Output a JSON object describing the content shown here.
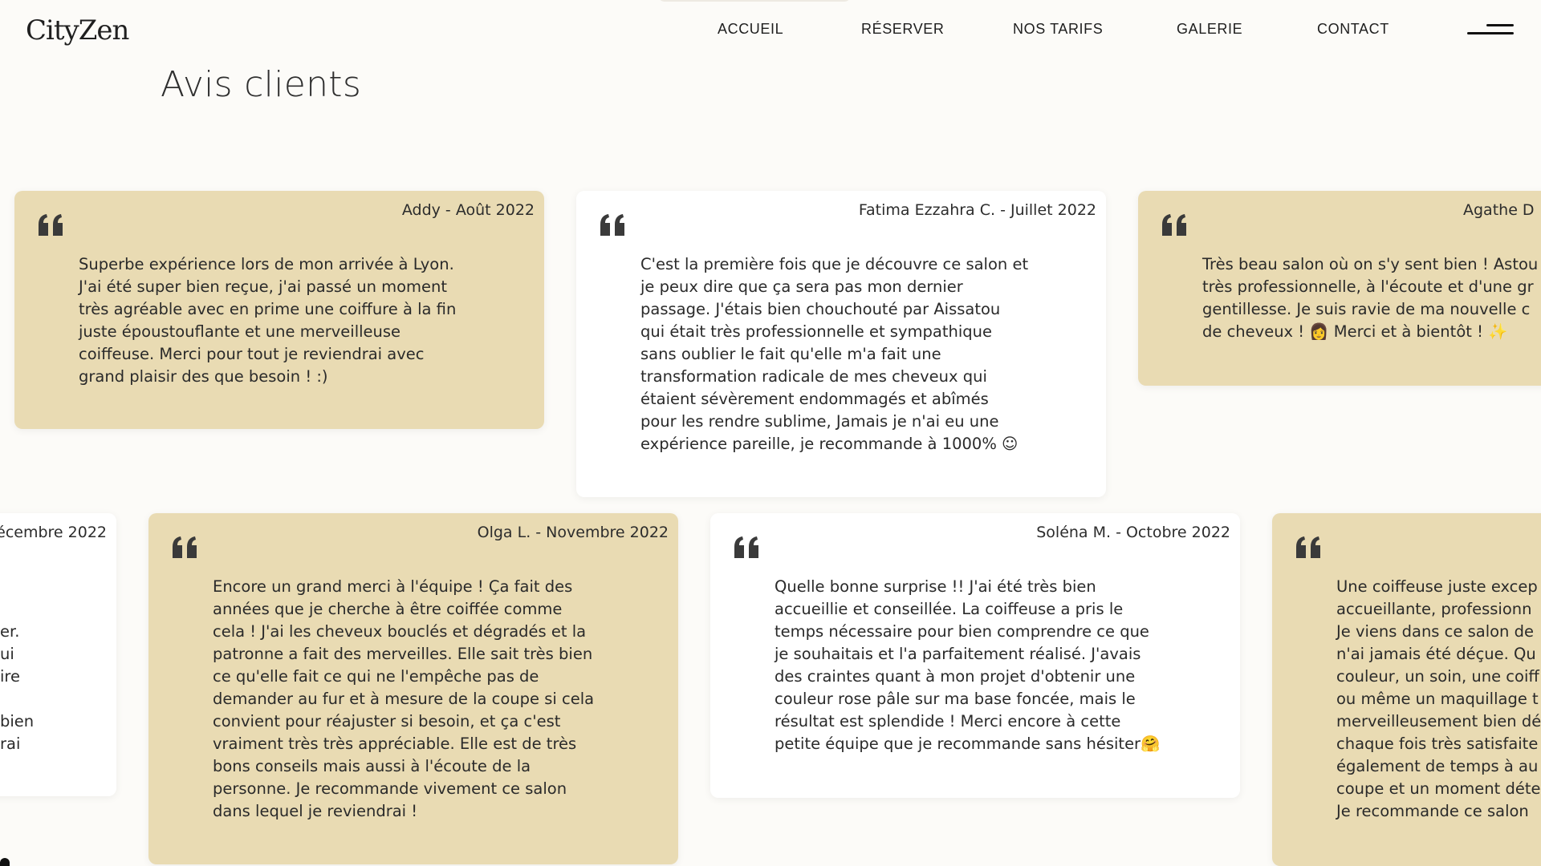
{
  "brand": {
    "logo": "CityZen"
  },
  "nav": {
    "items": [
      "ACCUEIL",
      "RÉSERVER",
      "NOS TARIFS",
      "GALERIE",
      "CONTACT"
    ]
  },
  "page": {
    "title": "Avis clients"
  },
  "reviews": [
    {
      "author": "Addy - Août 2022",
      "lines": [
        "Superbe expérience lors de mon arrivée à Lyon.",
        "J'ai été super bien reçue, j'ai passé un moment",
        "très agréable avec en prime une coiffure à la fin",
        "juste époustouflante et une merveilleuse",
        "coiffeuse. Merci pour tout je reviendrai avec",
        "grand plaisir des que besoin ! :)"
      ]
    },
    {
      "author": "Fatima Ezzahra C. - Juillet 2022",
      "lines": [
        "C'est la première fois que je découvre ce salon et",
        "je peux dire que ça sera pas mon dernier",
        "passage. J'étais bien chouchouté par Aissatou",
        "qui était très professionnelle et sympathique",
        "sans oublier le fait qu'elle m'a fait une",
        "transformation radicale de mes cheveux qui",
        "étaient sévèrement endommagés et abîmés",
        "pour les rendre sublime, Jamais je n'ai eu une",
        "expérience pareille, je recommande à 1000% ☺"
      ]
    },
    {
      "author": "Agathe D",
      "lines": [
        "Très beau salon où on s'y sent bien ! Astou",
        "très professionnelle, à l'écoute et d'une gr",
        "gentillesse. Je suis ravie de ma nouvelle c",
        "de cheveux ! 👩 Merci et à bientôt ! ✨"
      ]
    },
    {
      "author": "écembre 2022",
      "lines": [
        "",
        "",
        "er.",
        "ui",
        "ire",
        "",
        "bien",
        "rai"
      ]
    },
    {
      "author": "Olga L. - Novembre 2022",
      "lines": [
        "Encore un grand merci à l'équipe ! Ça fait des",
        "années que je cherche à être coiffée comme",
        "cela ! J'ai les cheveux bouclés et dégradés et la",
        "patronne a fait des merveilles. Elle sait très bien",
        "ce qu'elle fait ce qui ne l'empêche pas de",
        "demander au fur et à mesure de la coupe si cela",
        "convient pour réajuster si besoin, et ça c'est",
        "vraiment très très appréciable. Elle est de très",
        "bons conseils mais aussi à l'écoute de la",
        "personne. Je recommande vivement ce salon",
        "dans lequel je reviendrai !"
      ]
    },
    {
      "author": "Soléna M. - Octobre 2022",
      "lines": [
        "Quelle bonne surprise !! J'ai été très bien",
        "accueillie et conseillée. La coiffeuse a pris le",
        "temps nécessaire pour bien comprendre ce que",
        "je souhaitais et l'a parfaitement réalisé. J'avais",
        "des craintes quant à mon projet d'obtenir une",
        "couleur rose pâle sur ma base foncée, mais le",
        "résultat est splendide ! Merci encore à cette",
        "petite équipe que je recommande sans hésiter🤗"
      ]
    },
    {
      "author": "",
      "lines": [
        "Une coiffeuse juste excep",
        "accueillante, professionn",
        "Je viens dans ce salon de",
        "n'ai jamais été déçue. Qu",
        "couleur, un soin, une coiff",
        "ou même un maquillage t",
        "merveilleusement bien dé",
        "chaque fois très satisfaite",
        "également de temps à au",
        "coupe et un moment déte",
        "Je recommande ce salon"
      ]
    }
  ],
  "colors": {
    "tan": "#e9dbb3",
    "white": "#ffffff",
    "background": "#fcfbf8"
  },
  "icons": {
    "quote": "quote-icon",
    "menu": "menu-icon"
  }
}
